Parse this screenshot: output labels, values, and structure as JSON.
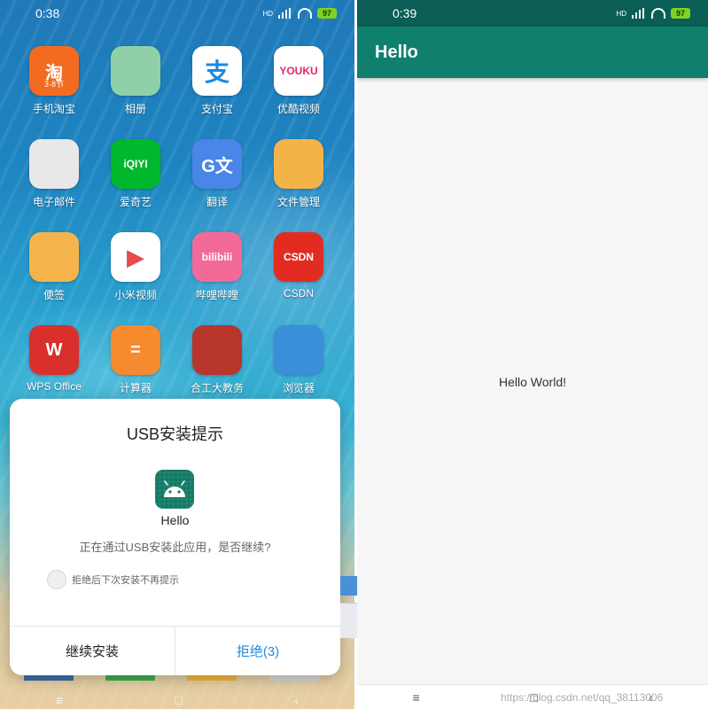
{
  "left_phone": {
    "status": {
      "time": "0:38",
      "battery": "97",
      "signal_label": "HD"
    },
    "apps": [
      {
        "label": "手机淘宝",
        "icon": "taobao-icon",
        "glyph": "淘",
        "sub": "3·8节",
        "bg": "#f26b21"
      },
      {
        "label": "相册",
        "icon": "gallery-icon",
        "glyph": "",
        "sub": "",
        "bg": "#8fd0a8"
      },
      {
        "label": "支付宝",
        "icon": "alipay-icon",
        "glyph": "支",
        "sub": "",
        "bg": "#ffffff"
      },
      {
        "label": "优酷视频",
        "icon": "youku-icon",
        "glyph": "YOUKU",
        "sub": "",
        "bg": "#ffffff"
      },
      {
        "label": "电子邮件",
        "icon": "mail-icon",
        "glyph": "",
        "sub": "",
        "bg": "#e8e8e8"
      },
      {
        "label": "爱奇艺",
        "icon": "iqiyi-icon",
        "glyph": "iQIYI",
        "sub": "",
        "bg": "#00b82b"
      },
      {
        "label": "翻译",
        "icon": "translate-icon",
        "glyph": "G文",
        "sub": "",
        "bg": "#4a86e8"
      },
      {
        "label": "文件管理",
        "icon": "folder-icon",
        "glyph": "",
        "sub": "",
        "bg": "#f3b447"
      },
      {
        "label": "便签",
        "icon": "notes-icon",
        "glyph": "",
        "sub": "",
        "bg": "#f4b44b"
      },
      {
        "label": "小米视频",
        "icon": "mi-video-icon",
        "glyph": "▶",
        "sub": "",
        "bg": "#ffffff"
      },
      {
        "label": "哔哩哔哩",
        "icon": "bilibili-icon",
        "glyph": "bilibili",
        "sub": "",
        "bg": "#f36a99"
      },
      {
        "label": "CSDN",
        "icon": "csdn-icon",
        "glyph": "CSDN",
        "sub": "",
        "bg": "#e22c22"
      },
      {
        "label": "WPS Office",
        "icon": "wps-icon",
        "glyph": "W",
        "sub": "",
        "bg": "#d9302c"
      },
      {
        "label": "计算器",
        "icon": "calculator-icon",
        "glyph": "=",
        "sub": "",
        "bg": "#f58a2e"
      },
      {
        "label": "合工大教务",
        "icon": "university-icon",
        "glyph": "",
        "sub": "",
        "bg": "#b8352b"
      },
      {
        "label": "浏览器",
        "icon": "browser-icon",
        "glyph": "",
        "sub": "",
        "bg": "#3a8fd9"
      }
    ],
    "dialog": {
      "title": "USB安装提示",
      "app_name": "Hello",
      "message": "正在通过USB安装此应用，是否继续?",
      "checkbox_label": "拒绝后下次安装不再提示",
      "continue_label": "继续安装",
      "reject_label": "拒绝(3)"
    }
  },
  "right_phone": {
    "status": {
      "time": "0:39",
      "battery": "97",
      "signal_label": "HD"
    },
    "app_bar_title": "Hello",
    "content_text": "Hello World!"
  },
  "watermark": "https://blog.csdn.net/qq_38113006",
  "colors": {
    "app_bar": "#0f7f6e",
    "status_bar": "#0a5e55",
    "reject_button": "#1f8be0",
    "battery": "#7ed321"
  }
}
